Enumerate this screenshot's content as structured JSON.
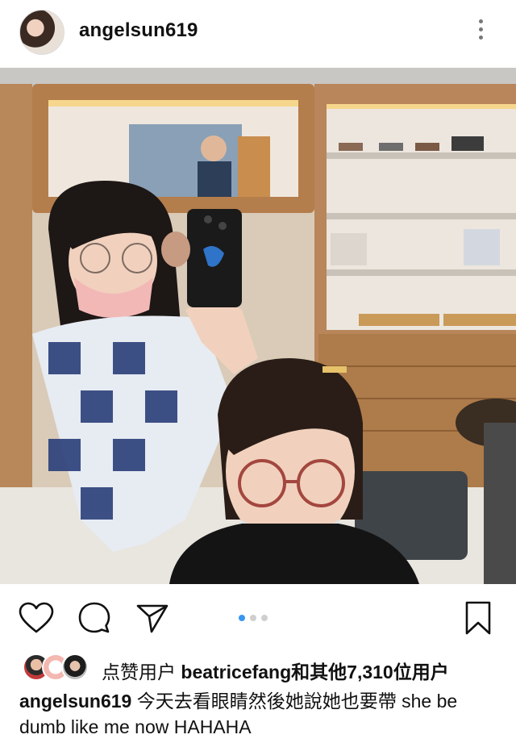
{
  "post": {
    "username": "angelsun619"
  },
  "carousel": {
    "index": 1,
    "count": 3
  },
  "likes": {
    "prefix": "点赞用户",
    "liker": "beatricefang",
    "suffix": "和其他7,310位用户"
  },
  "caption": {
    "username": "angelsun619",
    "text": " 今天去看眼睛然後她說她也要帶  she be dumb like me now HAHAHA"
  },
  "icons": [
    "more-options-icon",
    "heart-icon",
    "comment-icon",
    "share-icon",
    "bookmark-icon"
  ],
  "colors": {
    "accent": "#3897f0",
    "text": "#111111",
    "dot_inactive": "#cfcfcf"
  }
}
